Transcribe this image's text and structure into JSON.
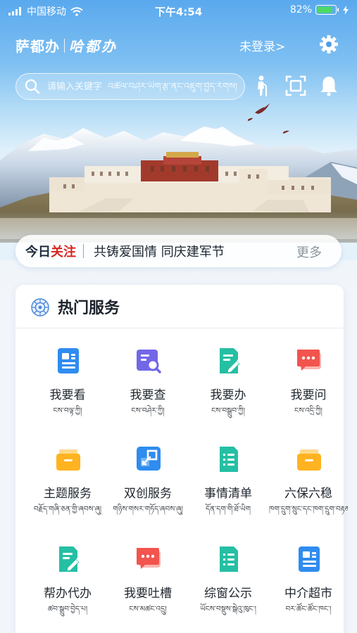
{
  "status_bar": {
    "carrier": "中国移动",
    "time": "下午4:54",
    "battery": "82%"
  },
  "header": {
    "brand_primary": "萨都办",
    "brand_secondary": "哈都办",
    "login_label": "未登录>",
    "icons": [
      "elder-mode-icon",
      "scan-icon",
      "bell-icon",
      "gear-icon"
    ]
  },
  "search": {
    "placeholder": "请输入关键字  འཚོལ་བཤེར་ཡིག་རྩ་ནང་འཇུག་བྱེད་རོགས།"
  },
  "news": {
    "tag_a": "今日",
    "tag_b": "关注",
    "title": "共铸爱国情 同庆建军节",
    "more": "更多"
  },
  "services": {
    "title": "热门服务",
    "items": [
      {
        "zh": "我要看",
        "bo": "ངས་བལྟ་ཀྱི།",
        "icon": "doc-icon",
        "color": "#2f8cf0"
      },
      {
        "zh": "我要查",
        "bo": "ངས་བཤེར་ཀྱི།",
        "icon": "search-doc-icon",
        "color": "#7367e8"
      },
      {
        "zh": "我要办",
        "bo": "ངས་བསྒྲུབ་ཀྱི།",
        "icon": "edit-doc-icon",
        "color": "#25bfa4"
      },
      {
        "zh": "我要问",
        "bo": "ངས་འདྲི་ཀྱི།",
        "icon": "chat-icon",
        "color": "#f2544e"
      },
      {
        "zh": "主题服务",
        "bo": "བརྗོད་གཞི་ཅན་གྱི་ཞབས་ཞུ།",
        "icon": "folder-icon",
        "color": "#ffb321"
      },
      {
        "zh": "双创服务",
        "bo": "གཉིས་གསར་གཏོད་ཞབས་ཞུ།",
        "icon": "expand-icon",
        "color": "#2f8cf0"
      },
      {
        "zh": "事情清单",
        "bo": "དོན་དག་གི་ཐོ་ཡིག",
        "icon": "list-doc-icon",
        "color": "#25bfa4"
      },
      {
        "zh": "六保六稳",
        "bo": "ཁག་དྲུག་སྲུང་དང་ཁག་དྲུག་བརྟན།",
        "icon": "folder-icon",
        "color": "#ffb321"
      },
      {
        "zh": "帮办代办",
        "bo": "ཚབ་སྒྲུབ་བྱེད་པ།",
        "icon": "edit-doc-icon",
        "color": "#25bfa4"
      },
      {
        "zh": "我要吐槽",
        "bo": "ངས་མཚང་འདྲུ།",
        "icon": "chat-icon",
        "color": "#f2544e"
      },
      {
        "zh": "综窗公示",
        "bo": "ཡོངས་བསྡུས་སྒེའུ་ཁུང་།",
        "icon": "list-doc-icon",
        "color": "#25bfa4"
      },
      {
        "zh": "中介超市",
        "bo": "བར་ཚོང་ཚོང་ཁང་།",
        "icon": "doc-icon",
        "color": "#2f8cf0"
      }
    ]
  },
  "colors": {
    "accent_red": "#d7261f",
    "sky_top": "#5aa9ee",
    "text_dark": "#1c232c"
  }
}
